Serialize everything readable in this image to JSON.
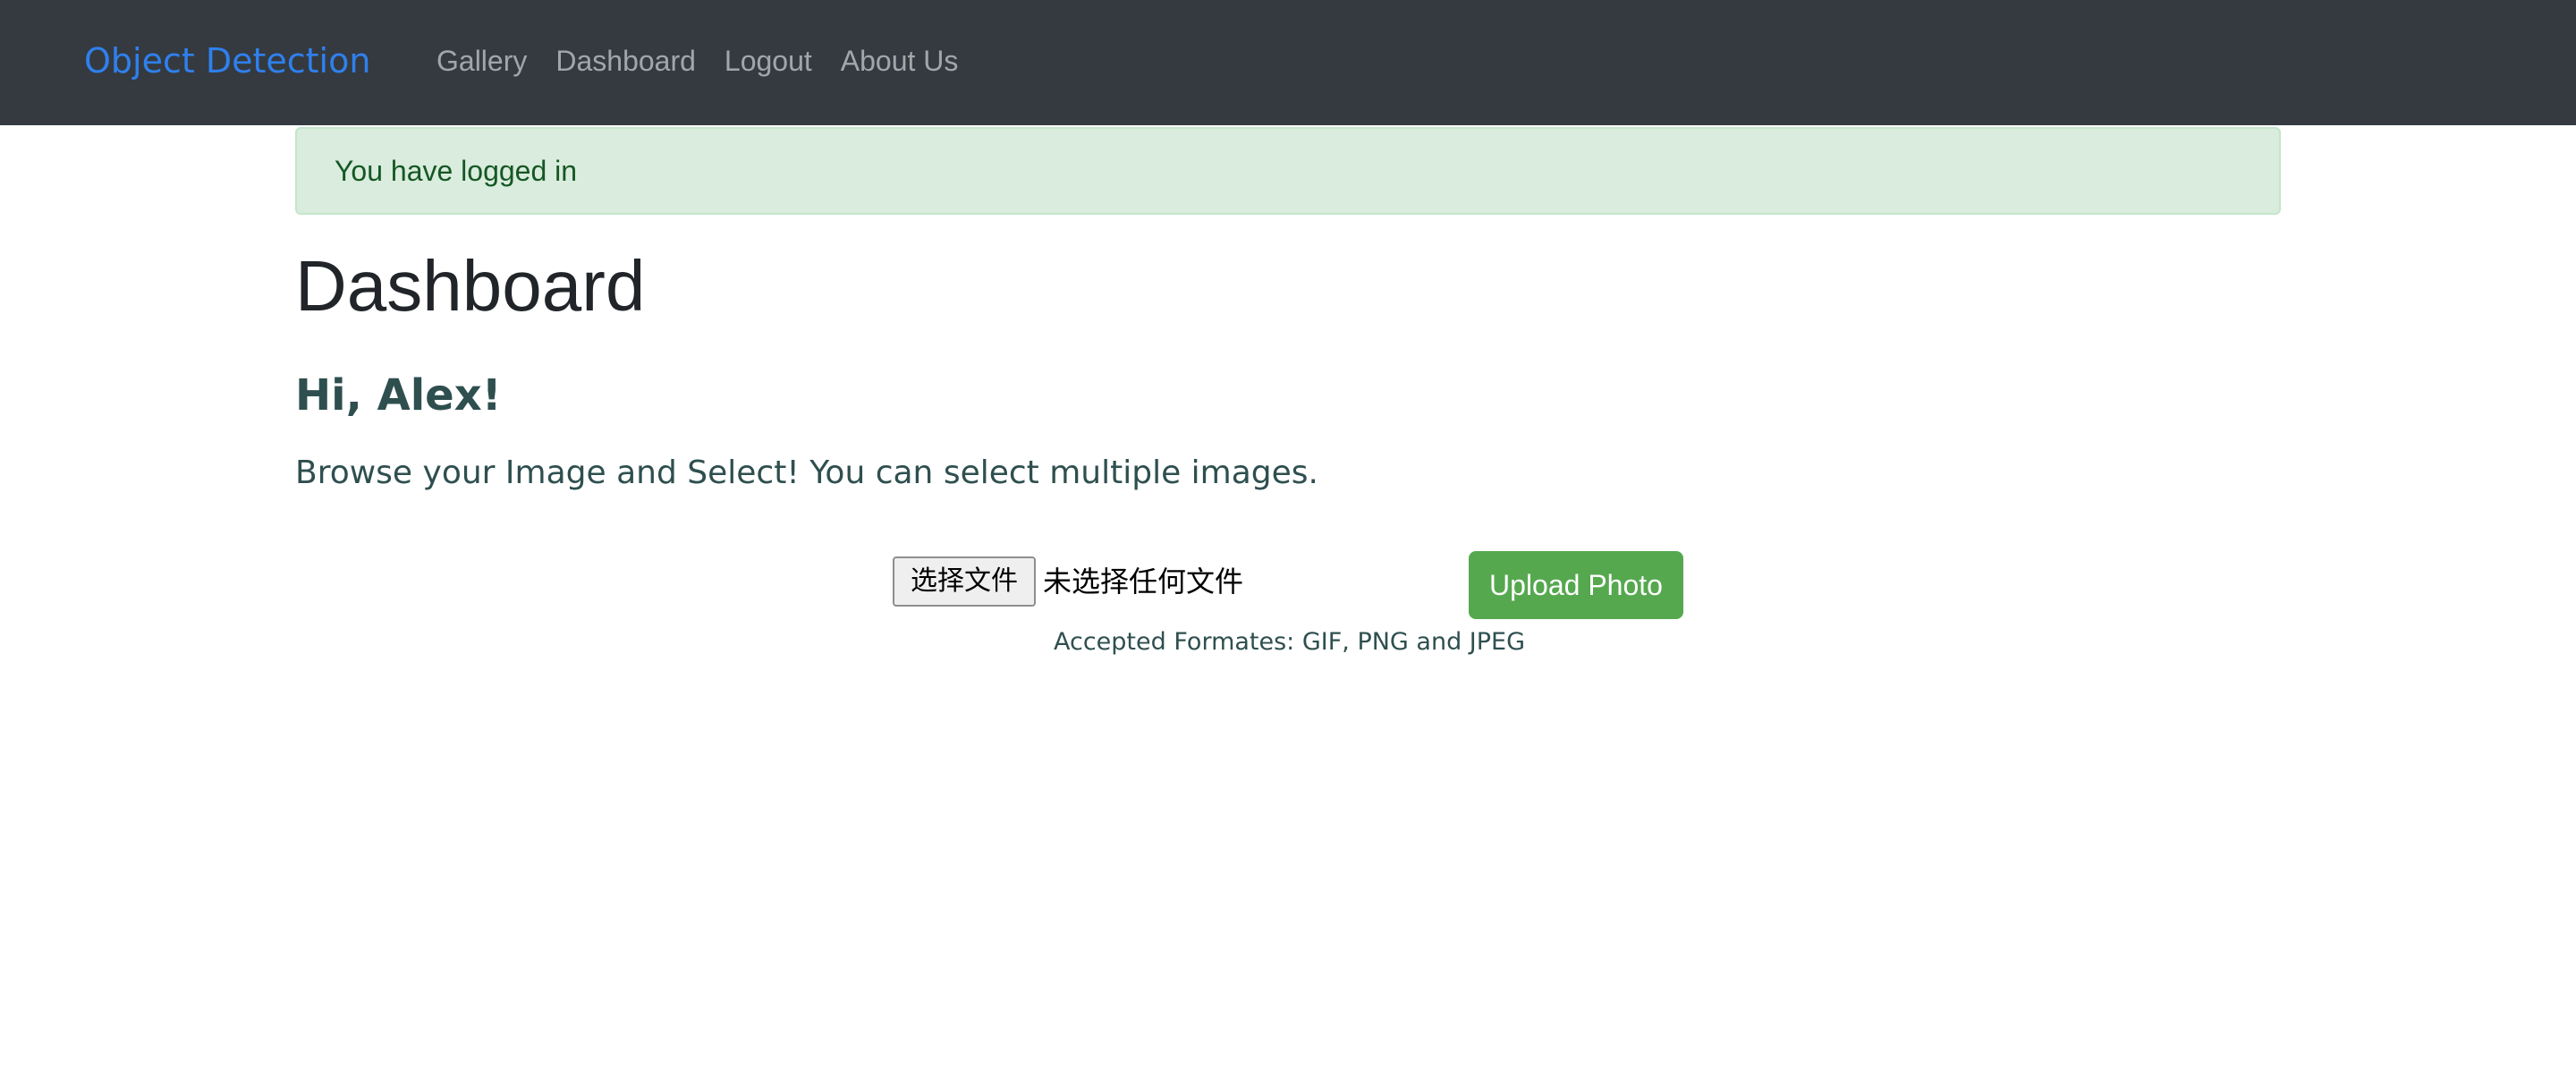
{
  "navbar": {
    "brand": "Object Detection",
    "links": [
      {
        "label": "Gallery"
      },
      {
        "label": "Dashboard"
      },
      {
        "label": "Logout"
      },
      {
        "label": "About Us"
      }
    ],
    "background_color": "#343a40",
    "brand_color": "#2f80ed"
  },
  "alert": {
    "message": "You have logged in",
    "type": "success"
  },
  "main": {
    "title": "Dashboard",
    "greeting": "Hi, Alex!",
    "instructions": "Browse your Image and Select! You can select multiple images."
  },
  "upload": {
    "file_button_label": "选择文件",
    "file_status": "未选择任何文件",
    "submit_label": "Upload Photo",
    "accepted_formats": "Accepted Formates: GIF, PNG and JPEG",
    "submit_color": "#56a84f"
  }
}
